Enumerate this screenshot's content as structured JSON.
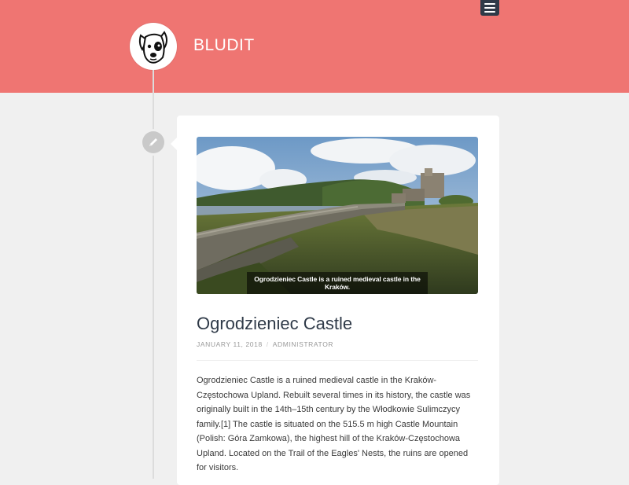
{
  "site": {
    "title": "BLUDIT",
    "menu_icon": "hamburger-menu-icon",
    "logo_icon": "dog-logo-icon"
  },
  "colors": {
    "header": "#ef7572",
    "background": "#f0f0f0",
    "title_text": "#2f3a48"
  },
  "post": {
    "edit_icon": "pencil-icon",
    "image_caption": "Ogrodzieniec Castle is a ruined medieval castle in the Kraków.",
    "title": "Ogrodzieniec Castle",
    "date": "JANUARY 11, 2018",
    "separator": "/",
    "author": "ADMINISTRATOR",
    "content": "Ogrodzieniec Castle is a ruined medieval castle in the Kraków-Częstochowa Upland. Rebuilt several times in its history, the castle was originally built in the 14th–15th century by the Włodkowie Sulimczycy family.[1] The castle is situated on the 515.5 m high Castle Mountain (Polish: Góra Zamkowa), the highest hill of the Kraków-Częstochowa Upland. Located on the Trail of the Eagles' Nests, the ruins are opened for visitors."
  }
}
